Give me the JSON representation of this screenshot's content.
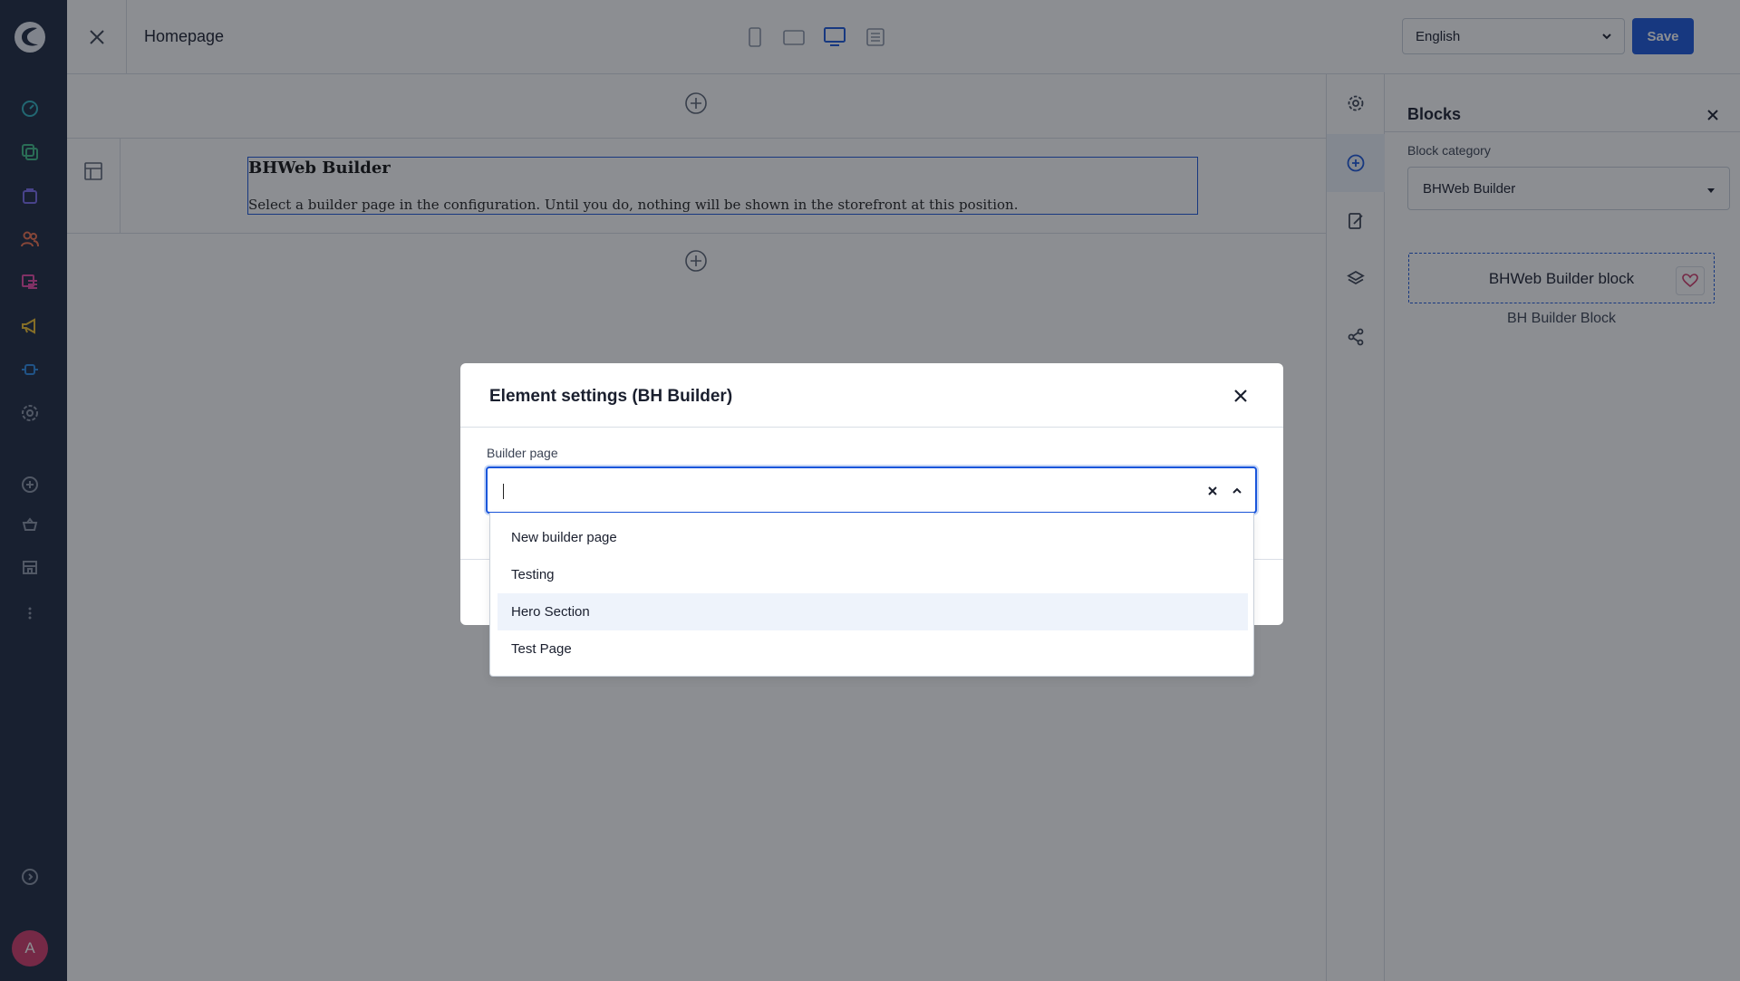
{
  "topbar": {
    "page_title": "Homepage",
    "language": "English",
    "save_label": "Save"
  },
  "canvas": {
    "block_title": "BHWeb Builder",
    "block_description": "Select a builder page in the configuration. Until you do, nothing will be shown in the storefront at this position."
  },
  "blocks_panel": {
    "title": "Blocks",
    "category_label": "Block category",
    "category_value": "BHWeb Builder",
    "block_card_label": "BHWeb Builder block",
    "block_name": "BH Builder Block"
  },
  "modal": {
    "title": "Element settings (BH Builder)",
    "field_label": "Builder page",
    "input_value": "",
    "options": [
      {
        "label": "New builder page"
      },
      {
        "label": "Testing"
      },
      {
        "label": "Hero Section"
      },
      {
        "label": "Test Page"
      }
    ]
  },
  "user": {
    "avatar_initial": "A"
  },
  "colors": {
    "sidebar_bg": "#1c2840",
    "accent": "#1a56db",
    "avatar": "#d33a6b",
    "overlay": "rgba(20,24,33,0.49)"
  }
}
